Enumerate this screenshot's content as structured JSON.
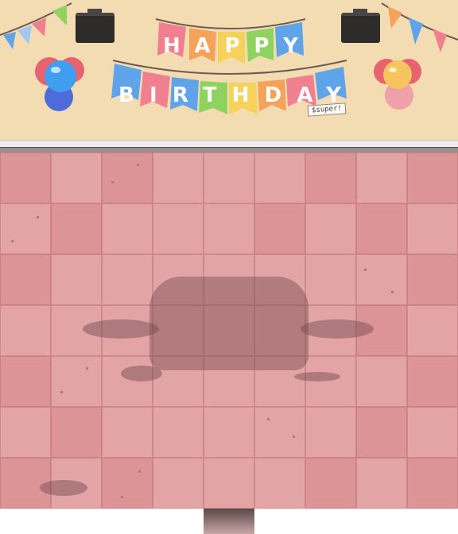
{
  "scene": {
    "banner_top_text": "HAPPY",
    "banner_bottom_text": "BIRTHDAY",
    "stamp_text": "$super!"
  },
  "colors": {
    "wall": "#f4dcb2",
    "floor_light": "#e3a4a6",
    "floor_dark": "#dc9496",
    "flag_pink": "#f07f90",
    "flag_orange": "#f5a25a",
    "flag_yellow": "#f7d25b",
    "flag_green": "#8fd35f",
    "flag_blue": "#5fa3e8"
  },
  "icons": [
    "bunting-left",
    "bunting-right",
    "speaker-left",
    "speaker-right",
    "balloons-blue",
    "balloons-pink",
    "door"
  ]
}
